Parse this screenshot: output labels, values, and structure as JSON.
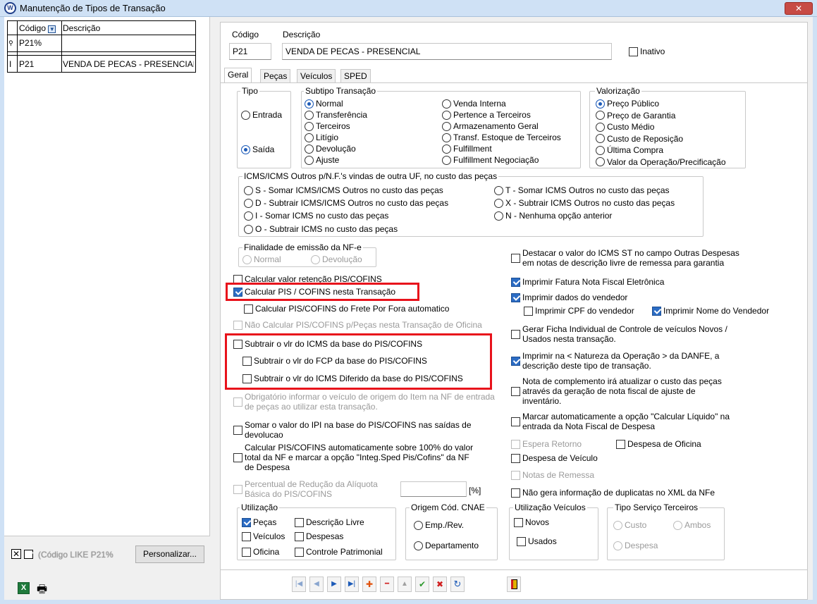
{
  "window": {
    "title": "Manutenção de Tipos de Transação",
    "close": "✕",
    "app_icon": "W"
  },
  "left": {
    "col_code": "Código",
    "col_desc": "Descrição",
    "filter_value": "P21%",
    "row": {
      "code": "P21",
      "desc": "VENDA DE PECAS - PRESENCIAL"
    },
    "filter_text": "(Código LIKE P21%",
    "customize_label": "Personalizar..."
  },
  "header": {
    "code_label": "Código",
    "desc_label": "Descrição",
    "code_value": "P21",
    "desc_value": "VENDA DE PECAS - PRESENCIAL",
    "inactive_label": "Inativo"
  },
  "tabs": [
    "Geral",
    "Peças",
    "Veículos",
    "SPED"
  ],
  "tipo": {
    "title": "Tipo",
    "entrada": "Entrada",
    "saida": "Saída"
  },
  "subtipo": {
    "title": "Subtipo Transação",
    "col1": [
      "Normal",
      "Transferência",
      "Terceiros",
      "Litígio",
      "Devolução",
      "Ajuste"
    ],
    "col2": [
      "Venda Interna",
      "Pertence a Terceiros",
      "Armazenamento Geral",
      "Transf. Estoque de Terceiros",
      "Fulfillment",
      "Fulfillment Negociação"
    ]
  },
  "valorizacao": {
    "title": "Valorização",
    "items": [
      "Preço Público",
      "Preço de Garantia",
      "Custo Médio",
      "Custo de Reposição",
      "Última Compra",
      "Valor da Operação/Precificação"
    ]
  },
  "icms": {
    "title": "ICMS/ICMS Outros p/N.F.'s vindas de outra UF, no custo das peças",
    "col1": [
      "S - Somar ICMS/ICMS Outros no custo das peças",
      "D - Subtrair ICMS/ICMS Outros no custo das peças",
      "I - Somar ICMS no custo das peças",
      "O - Subtrair ICMS no custo das peças"
    ],
    "col2": [
      "T - Somar ICMS Outros no custo das peças",
      "X - Subtrair ICMS Outros no custo das peças",
      "N - Nenhuma opção anterior"
    ]
  },
  "finalidade": {
    "title": "Finalidade de emissão da NF-e",
    "normal": "Normal",
    "devolucao": "Devolução"
  },
  "leftchecks": {
    "retencao": "Calcular valor retenção PIS/COFINS",
    "calc_pis": "Calcular PIS / COFINS nesta Transação",
    "frete": "Calcular PIS/COFINS do Frete Por Fora automatico",
    "nao_calc": "Não Calcular PIS/COFINS p/Peças nesta Transação de Oficina",
    "sub_icms": "Subtrair o vlr do ICMS da base do PIS/COFINS",
    "sub_fcp": "Subtrair o vlr do FCP da base do PIS/COFINS",
    "sub_dif": "Subtrair o vlr do ICMS Diferido da base do PIS/COFINS",
    "obrig": "Obrigatório informar o veículo de origem do Item na NF de entrada de peças ao utilizar esta transação.",
    "somar_ipi": "Somar o valor do IPI na base do PIS/COFINS nas saídas de devolucao",
    "calc100": "Calcular PIS/COFINS automaticamente sobre 100% do valor total da NF e marcar a opção \"Integ.Sped Pis/Cofins\" da NF de Despesa",
    "perc": "Percentual de Redução da Alíquota Básica do PIS/COFINS",
    "perc_unit": "[%]"
  },
  "rightchecks": {
    "destacar": "Destacar o valor do ICMS ST no campo Outras Despesas em notas de descrição livre de remessa para garantia",
    "fatura": "Imprimir Fatura Nota Fiscal Eletrônica",
    "vendedor": "Imprimir dados do vendedor",
    "cpf": "Imprimir CPF do vendedor",
    "nome": "Imprimir Nome do Vendedor",
    "ficha": "Gerar Ficha Individual de Controle de veículos Novos / Usados  nesta transação.",
    "natureza": "Imprimir na < Natureza da Operação > da DANFE, a descrição deste tipo de transação.",
    "complemento": "Nota de complemento irá atualizar o custo das peças através da geração de nota fiscal de ajuste de inventário.",
    "liquido": "Marcar automaticamente a opção \"Calcular Líquido\" na entrada da Nota Fiscal de Despesa",
    "espera": "Espera Retorno",
    "desp_oficina": "Despesa de Oficina",
    "desp_veiculo": "Despesa de Veículo",
    "remessa": "Notas de Remessa",
    "duplicatas": "Não gera informação de duplicatas no XML da NFe"
  },
  "utilizacao": {
    "title": "Utilização",
    "pecas": "Peças",
    "desc_livre": "Descrição Livre",
    "veiculos": "Veículos",
    "despesas": "Despesas",
    "oficina": "Oficina",
    "controle": "Controle Patrimonial"
  },
  "origem": {
    "title": "Origem Cód. CNAE",
    "emp": "Emp./Rev.",
    "depto": "Departamento"
  },
  "util_veic": {
    "title": "Utilização Veículos",
    "novos": "Novos",
    "usados": "Usados"
  },
  "servico": {
    "title": "Tipo Serviço Terceiros",
    "custo": "Custo",
    "ambos": "Ambos",
    "despesa": "Despesa"
  },
  "nav": {
    "first": "|◀",
    "prev": "◀",
    "next": "▶",
    "last": "▶|",
    "add": "✚",
    "del": "━",
    "up": "▲",
    "ok": "✔",
    "cancel": "✖",
    "refresh": "↻"
  },
  "colors": {
    "accent": "#1d5bb8",
    "highlight": "#e8121b"
  }
}
